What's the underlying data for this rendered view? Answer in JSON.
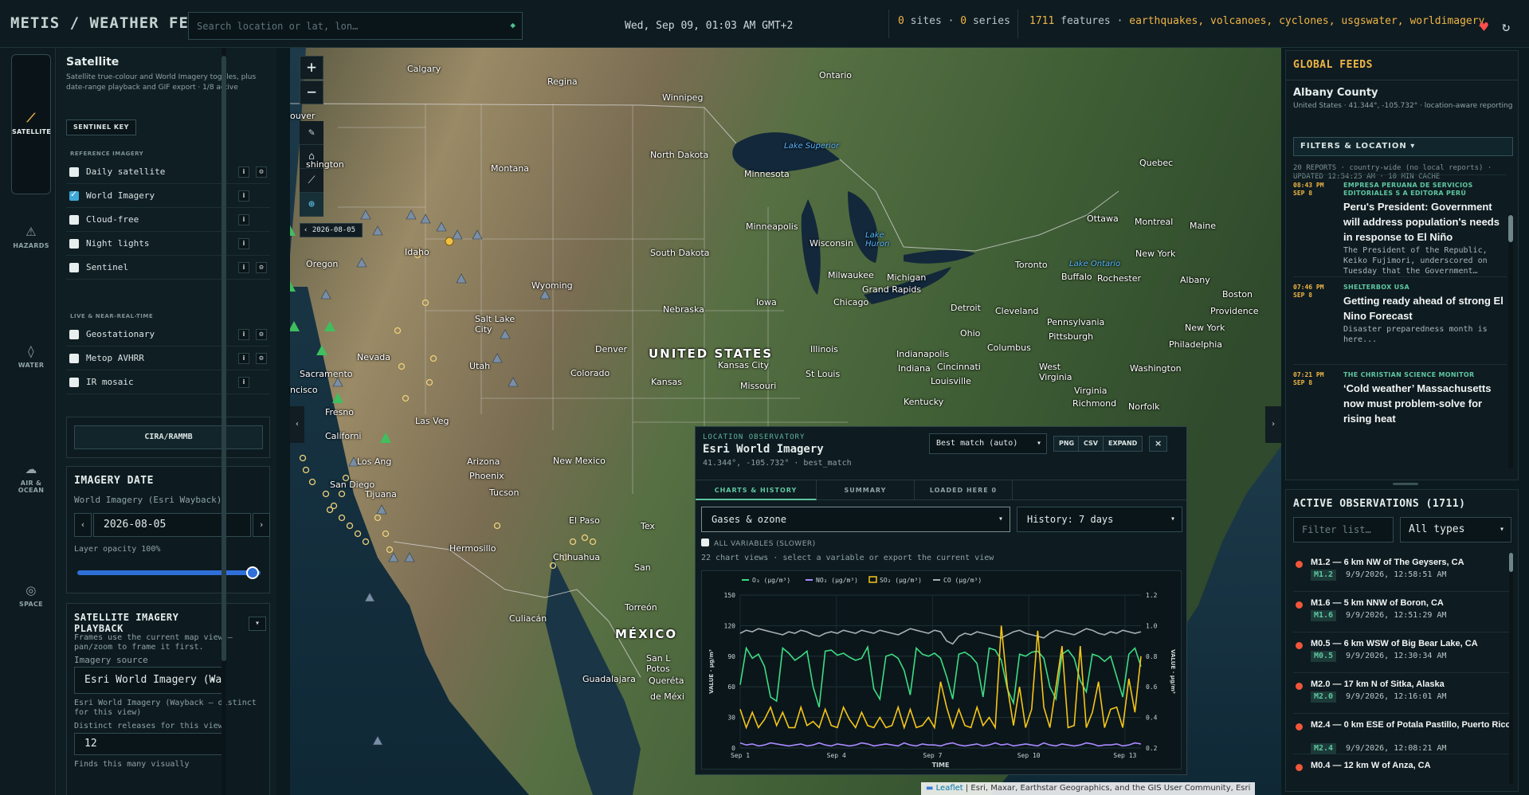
{
  "header": {
    "brand": "METIS / WEATHER FEEDS",
    "search_placeholder": "Search location or lat, lon…",
    "datetime": "Wed, Sep 09, 01:03 AM GMT+2",
    "sites_count": "0",
    "sites_word": "sites",
    "series_count": "0",
    "series_word": "series",
    "features_count": "1711",
    "features_word": "features",
    "feature_layers": "earthquakes, volcanoes, cyclones, usgswater, worldimagery"
  },
  "rail": {
    "satellite": "SATELLITE",
    "hazards": "HAZARDS",
    "water": "WATER",
    "air_ocean_1": "AIR &",
    "air_ocean_2": "OCEAN",
    "space": "SPACE"
  },
  "left_panel": {
    "title": "Satellite",
    "description": "Satellite true-colour and World Imagery toggles, plus date-range playback and GIF export · 1/8 active",
    "sentinel_key": "SENTINEL KEY",
    "reference_heading": "REFERENCE IMAGERY",
    "reference_layers": [
      {
        "label": "Daily satellite",
        "checked": false
      },
      {
        "label": "World Imagery",
        "checked": true
      },
      {
        "label": "Cloud-free",
        "checked": false
      },
      {
        "label": "Night lights",
        "checked": false
      },
      {
        "label": "Sentinel",
        "checked": false
      }
    ],
    "live_heading": "LIVE & NEAR-REAL-TIME",
    "live_layers": [
      {
        "label": "Geostationary",
        "checked": false
      },
      {
        "label": "Metop AVHRR",
        "checked": false
      },
      {
        "label": "IR mosaic",
        "checked": false
      }
    ],
    "info_label": "i",
    "cira_button": "CIRA/RAMMB",
    "imagery_date": {
      "title": "IMAGERY DATE",
      "source": "World Imagery (Esri Wayback)",
      "date": "2026-08-05",
      "prev": "‹",
      "next": "›",
      "opacity_label": "Layer opacity 100%",
      "opacity": 1.0
    },
    "playback": {
      "title_line1": "SATELLITE IMAGERY",
      "title_line2": "PLAYBACK",
      "collapse": "▾",
      "desc": "Frames use the current map view — pan/zoom to frame it first.",
      "source_label": "Imagery source",
      "source_value": "Esri World Imagery (Wayt",
      "source_note": "Esri World Imagery (Wayback — distinct for this view)",
      "releases_label": "Distinct releases for this view",
      "releases_value": "12",
      "finds_label": "Finds this many visually"
    }
  },
  "map": {
    "zoom_in": "+",
    "zoom_out": "−",
    "date_tag": "‹ 2026-08-05",
    "labels": {
      "calgary": "Calgary",
      "regina": "Regina",
      "winnipeg": "Winnipeg",
      "ontario": "Ontario",
      "quebec": "Quebec",
      "vancouver": "ouver",
      "washington": "shington",
      "montana": "Montana",
      "north_dakota": "North Dakota",
      "minnesota": "Minnesota",
      "lake_superior": "Lake Superior",
      "lake_huron": "Lake\nHuron",
      "ottawa": "Ottawa",
      "montreal": "Montreal",
      "maine": "Maine",
      "idaho": "Idaho",
      "oregon": "Oregon",
      "south_dakota": "South Dakota",
      "minneapolis": "Minneapolis",
      "wisconsin": "Wisconsin",
      "wyoming": "Wyoming",
      "toronto": "Toronto",
      "lake_ontario": "Lake Ontario",
      "new_york": "New York",
      "buffalo": "Buffalo",
      "rochester": "Rochester",
      "albany": "Albany",
      "boston": "Boston",
      "milwaukee": "Milwaukee",
      "michigan": "Michigan",
      "grand_rapids": "Grand Rapids",
      "providence": "Providence",
      "nebraska": "Nebraska",
      "iowa": "Iowa",
      "chicago": "Chicago",
      "detroit": "Detroit",
      "cleveland": "Cleveland",
      "salt_lake": "Salt Lake\nCity",
      "pennsylvania": "Pennsylvania",
      "new_york_city": "New York",
      "ohio": "Ohio",
      "pittsburgh": "Pittsburgh",
      "philadelphia": "Philadelphia",
      "denver": "Denver",
      "united_states": "UNITED STATES",
      "illinois": "Illinois",
      "columbus": "Columbus",
      "nevada": "Nevada",
      "indianapolis": "Indianapolis",
      "utah": "Utah",
      "kansas_city": "Kansas City",
      "colorado": "Colorado",
      "st_louis": "St Louis",
      "indiana": "Indiana",
      "cincinnati": "Cincinnati",
      "west_virginia": "West\nVirginia",
      "washington_dc": "Washington",
      "sacramento": "Sacramento",
      "kansas": "Kansas",
      "louisville": "Louisville",
      "san_francisco": "ncisco",
      "missouri": "Missouri",
      "virginia": "Virginia",
      "richmond": "Richmond",
      "fresno": "Fresno",
      "kentucky": "Kentucky",
      "norfolk": "Norfolk",
      "las_vegas": "Las Veg",
      "california": "Californi",
      "los_angeles": "Los Ang",
      "arizona": "Arizona",
      "new_mexico": "New Mexico",
      "phoenix": "Phoenix",
      "san_diego": "San Diego",
      "tijuana": "Tijuana",
      "tucson": "Tucson",
      "el_paso": "El Paso",
      "texas": "Tex",
      "hermosillo": "Hermosillo",
      "chihuahua": "Chihuahua",
      "san": "San",
      "torreon": "Torreón",
      "culiacan": "Culiacán",
      "mexico": "MÉXICO",
      "san_luis": "San L\nPotos",
      "guadalajara": "Guadalajara",
      "queretaro": "Queréta",
      "de_mexico": "de Méxi"
    },
    "attribution_link": "Leaflet",
    "attribution_text": " | Esri, Maxar, Earthstar Geographics, and the GIS User Community, Esri"
  },
  "observatory": {
    "kicker": "LOCATION OBSERVATORY",
    "title": "Esri World Imagery",
    "coords": "41.344°, -105.732° · best_match",
    "match_select": "Best match (auto)",
    "btn_png": "PNG",
    "btn_csv": "CSV",
    "btn_expand": "EXPAND",
    "btn_close": "×",
    "tabs": [
      "CHARTS & HISTORY",
      "SUMMARY",
      "LOADED HERE 0"
    ],
    "variable_select": "Gases & ozone",
    "history_select": "History: 7 days",
    "all_variables": "ALL VARIABLES (SLOWER)",
    "hint": "22 chart views · select a variable or export the current view"
  },
  "chart_data": {
    "type": "line",
    "title": "",
    "xlabel": "TIME",
    "ylabel": "VALUE · µg/m³",
    "ylabel_right": "VALUE · µg/m³",
    "x_ticks": [
      "Sep 1",
      "Sep 4",
      "Sep 7",
      "Sep 10",
      "Sep 13"
    ],
    "x_range": [
      0,
      12.5
    ],
    "y_range": [
      0,
      150
    ],
    "y_ticks": [
      0,
      30,
      60,
      90,
      120,
      150
    ],
    "y2_range": [
      0.2,
      1.2
    ],
    "y2_ticks": [
      "0.2",
      "0.4",
      "0.6",
      "0.8",
      "1.0",
      "1.2"
    ],
    "legend_position": "top",
    "series": [
      {
        "name": "O₃ (µg/m³)",
        "color": "#3ddc84",
        "axis": "left",
        "values": [
          62,
          98,
          88,
          92,
          80,
          50,
          46,
          98,
          93,
          86,
          90,
          95,
          60,
          40,
          95,
          96,
          91,
          93,
          89,
          86,
          88,
          99,
          58,
          48,
          90,
          92,
          88,
          76,
          52,
          98,
          92,
          90,
          93,
          88,
          70,
          48,
          92,
          94,
          90,
          83,
          50,
          98,
          96,
          86,
          58,
          44,
          92,
          90,
          94,
          95,
          88,
          60,
          48,
          92,
          96,
          88,
          66,
          55,
          92,
          90,
          85,
          90,
          70,
          50,
          92,
          98,
          80
        ]
      },
      {
        "name": "NO₂ (µg/m³)",
        "color": "#a98aff",
        "axis": "left",
        "values": [
          5,
          3,
          4,
          2,
          3,
          5,
          4,
          3,
          2,
          3,
          4,
          2,
          3,
          5,
          3,
          2,
          4,
          3,
          2,
          3,
          5,
          4,
          2,
          3,
          4,
          3,
          2,
          5,
          3,
          2,
          4,
          3,
          3,
          2,
          4,
          5,
          3,
          2,
          3,
          4,
          2,
          3,
          5,
          3,
          4,
          2,
          3,
          4,
          3,
          2,
          5,
          3,
          2,
          4,
          3,
          2,
          3,
          5,
          4,
          2,
          3,
          3,
          4,
          2,
          3,
          5,
          4
        ]
      },
      {
        "name": "SO₂ (µg/m³)",
        "color": "#f5c518",
        "axis": "left",
        "values": [
          38,
          20,
          35,
          20,
          28,
          40,
          22,
          35,
          20,
          20,
          40,
          22,
          26,
          20,
          38,
          22,
          20,
          40,
          28,
          20,
          35,
          22,
          20,
          30,
          20,
          22,
          40,
          20,
          38,
          20,
          22,
          30,
          20,
          65,
          40,
          20,
          38,
          22,
          20,
          40,
          22,
          30,
          20,
          120,
          60,
          22,
          60,
          20,
          38,
          115,
          40,
          20,
          60,
          100,
          20,
          22,
          100,
          20,
          35,
          65,
          20,
          38,
          40,
          20,
          68,
          35,
          90
        ]
      },
      {
        "name": "CO (µg/m³)",
        "color": "#a6b0b4",
        "axis": "right",
        "values": [
          0.95,
          0.97,
          0.96,
          0.98,
          0.97,
          0.96,
          0.95,
          0.94,
          0.96,
          0.95,
          0.97,
          0.96,
          0.94,
          0.93,
          0.95,
          0.96,
          0.95,
          0.97,
          0.96,
          0.95,
          0.97,
          0.96,
          0.95,
          0.97,
          0.96,
          0.95,
          0.94,
          0.96,
          0.98,
          0.97,
          0.96,
          0.95,
          0.97,
          0.96,
          0.9,
          0.88,
          0.93,
          0.95,
          0.94,
          0.96,
          0.95,
          0.94,
          0.93,
          0.92,
          0.94,
          0.96,
          0.97,
          0.95,
          0.94,
          0.93,
          0.92,
          0.95,
          0.97,
          0.96,
          0.95,
          0.94,
          0.96,
          0.98,
          0.97,
          0.95,
          0.94,
          0.96,
          0.95,
          0.97,
          0.96,
          0.95,
          0.96
        ]
      }
    ]
  },
  "global_feeds": {
    "title": "GLOBAL FEEDS",
    "location_name": "Albany County",
    "location_desc": "United States · 41.344°, -105.732° · location-aware reporting",
    "filters_btn": "FILTERS & LOCATION ▾",
    "meta": "20 REPORTS · country-wide (no local reports) · UPDATED 12:54:25 AM · 10 MIN CACHE",
    "items": [
      {
        "time": "08:43 PM\nSEP 8",
        "source": "EMPRESA PERUANA DE SERVICIOS EDITORIALES S A EDITORA PERÚ",
        "headline": "Peru's President: Government will address population's needs in response to El Niño",
        "body": "The President of the Republic, Keiko Fujimori, underscored on Tuesday that the Government…"
      },
      {
        "time": "07:46 PM\nSEP 8",
        "source": "SHELTERBOX USA",
        "headline": "Getting ready ahead of strong El Nino Forecast",
        "body": "Disaster preparedness month is here..."
      },
      {
        "time": "07:21 PM\nSEP 8",
        "source": "THE CHRISTIAN SCIENCE MONITOR",
        "headline": "‘Cold weather’ Massachusetts now must problem-solve for rising heat",
        "body": ""
      }
    ]
  },
  "active_obs": {
    "title": "ACTIVE OBSERVATIONS (1711)",
    "filter_placeholder": "Filter list…",
    "type_select": "All types",
    "items": [
      {
        "title": "M1.2 — 6 km NW of The Geysers, CA",
        "mag": "M1.2",
        "when": "9/9/2026, 12:58:51 AM"
      },
      {
        "title": "M1.6 — 5 km NNW of Boron, CA",
        "mag": "M1.6",
        "when": "9/9/2026, 12:51:29 AM"
      },
      {
        "title": "M0.5 — 6 km WSW of Big Bear Lake, CA",
        "mag": "M0.5",
        "when": "9/9/2026, 12:30:34 AM"
      },
      {
        "title": "M2.0 — 17 km N of Sitka, Alaska",
        "mag": "M2.0",
        "when": "9/9/2026, 12:16:01 AM"
      },
      {
        "title": "M2.4 — 0 km ESE of Potala Pastillo, Puerto Rico",
        "mag": "M2.4",
        "when": "9/9/2026, 12:08:21 AM"
      },
      {
        "title": "M0.4 — 12 km W of Anza, CA",
        "mag": "",
        "when": ""
      }
    ]
  }
}
